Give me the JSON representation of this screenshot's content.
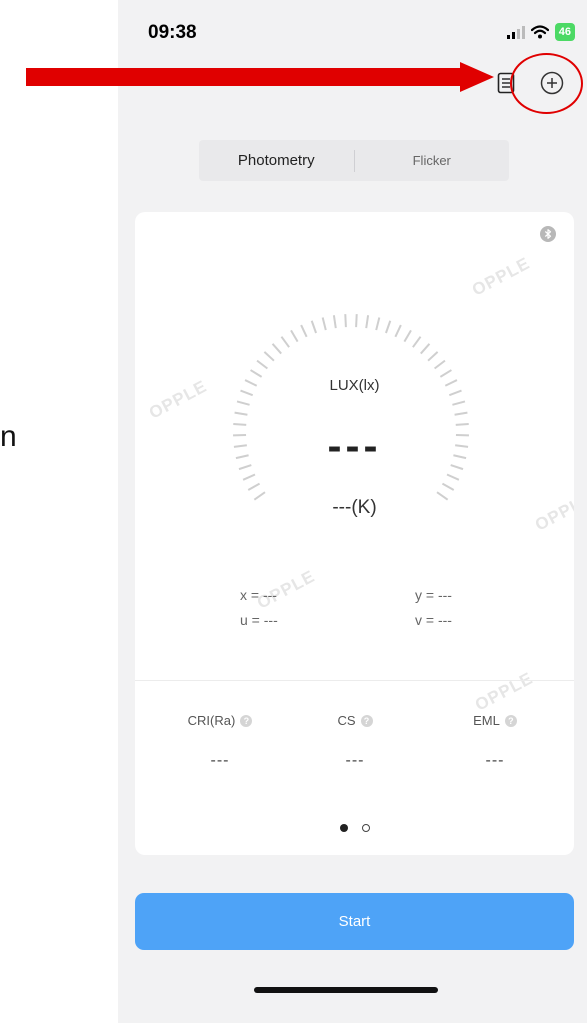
{
  "status_bar": {
    "time": "09:38",
    "battery": "46"
  },
  "tabs": [
    {
      "label": "Photometry",
      "active": true
    },
    {
      "label": "Flicker",
      "active": false
    }
  ],
  "watermark": "OPPLE",
  "edge_text": "n",
  "meter": {
    "lux_label": "LUX(lx)",
    "lux_value": "---",
    "cct_value": "---(K)"
  },
  "coordinates": {
    "x": "x = ---",
    "y": "y = ---",
    "u": "u = ---",
    "v": "v = ---"
  },
  "metrics": [
    {
      "label": "CRI(Ra)",
      "value": "---"
    },
    {
      "label": "CS",
      "value": "---"
    },
    {
      "label": "EML",
      "value": "---"
    }
  ],
  "help_mark": "?",
  "pager": {
    "count": 2,
    "active": 0
  },
  "start_button": "Start",
  "colors": {
    "accent": "#4ea3f7",
    "annotation": "#e00000",
    "background": "#f2f2f3",
    "battery": "#4cd964"
  },
  "icons": [
    "signal-icon",
    "wifi-icon",
    "battery-icon",
    "list-icon",
    "plus-circle-icon",
    "bluetooth-icon"
  ]
}
